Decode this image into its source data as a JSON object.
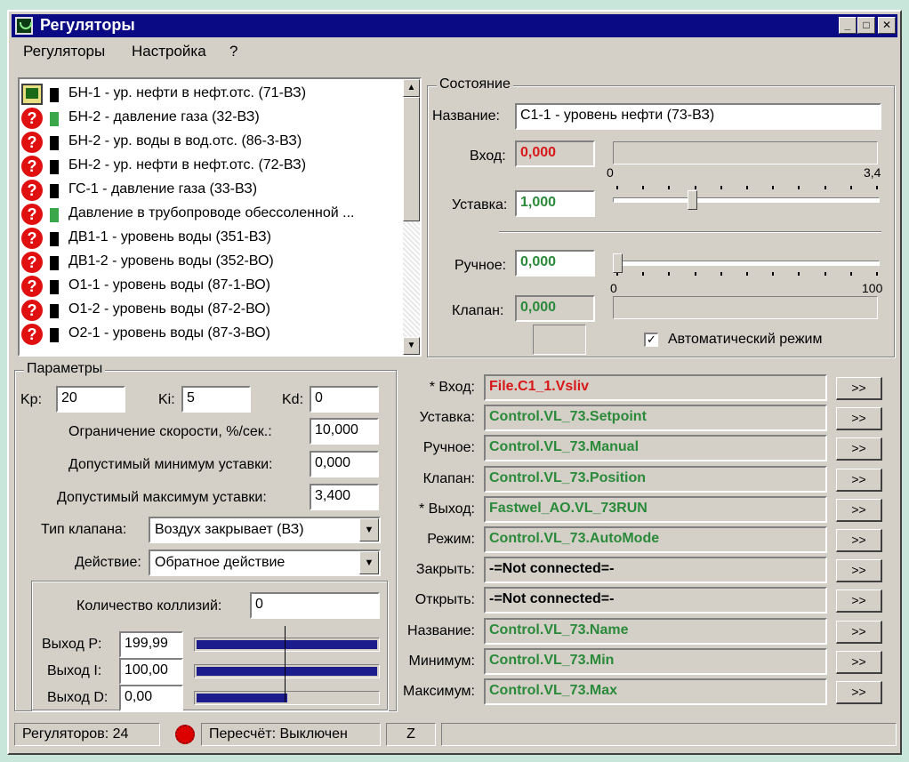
{
  "window": {
    "title": "Регуляторы",
    "buttons": {
      "minimize": "_",
      "maximize": "□",
      "close": "✕"
    }
  },
  "menu": [
    "Регуляторы",
    "Настройка",
    "?"
  ],
  "list": {
    "items": [
      {
        "label": "БН-1 - ур. нефти в нефт.отс. (71-ВЗ)",
        "status": "ok",
        "indicator": "black"
      },
      {
        "label": "БН-2 - давление газа (32-ВЗ)",
        "status": "unknown",
        "indicator": "green"
      },
      {
        "label": "БН-2 - ур. воды в вод.отс. (86-3-ВЗ)",
        "status": "unknown",
        "indicator": "black"
      },
      {
        "label": "БН-2 - ур. нефти в нефт.отс. (72-ВЗ)",
        "status": "unknown",
        "indicator": "black"
      },
      {
        "label": "ГС-1 - давление газа (33-ВЗ)",
        "status": "unknown",
        "indicator": "black"
      },
      {
        "label": "Давление в трубопроводе обессоленной ...",
        "status": "unknown",
        "indicator": "green"
      },
      {
        "label": "ДВ1-1 - уровень воды (351-ВЗ)",
        "status": "unknown",
        "indicator": "black"
      },
      {
        "label": "ДВ1-2 - уровень воды (352-ВО)",
        "status": "unknown",
        "indicator": "black"
      },
      {
        "label": "О1-1 - уровень воды (87-1-ВО)",
        "status": "unknown",
        "indicator": "black"
      },
      {
        "label": "О1-2 - уровень воды (87-2-ВО)",
        "status": "unknown",
        "indicator": "black"
      },
      {
        "label": "О2-1 - уровень воды (87-3-ВО)",
        "status": "unknown",
        "indicator": "black"
      }
    ],
    "unknown_glyph": "?"
  },
  "state": {
    "title": "Состояние",
    "name_label": "Название:",
    "name_value": "С1-1 - уровень нефти (73-ВЗ)",
    "input_label": "Вход:",
    "input_value": "0,000",
    "scale_min": "0",
    "scale_max": "3,4",
    "setpoint_label": "Уставка:",
    "setpoint_value": "1,000",
    "setpoint_fraction": 0.29,
    "manual_label": "Ручное:",
    "manual_value": "0,000",
    "manual_fraction": 0.0,
    "manual_scale_min": "0",
    "manual_scale_max": "100",
    "valve_label": "Клапан:",
    "valve_value": "0,000",
    "auto_mode_label": "Автоматический режим",
    "auto_mode_checked": "✓"
  },
  "params": {
    "title": "Параметры",
    "kp_label": "Kp:",
    "kp": "20",
    "ki_label": "Ki:",
    "ki": "5",
    "kd_label": "Kd:",
    "kd": "0",
    "speed_limit_label": "Ограничение скорости, %/сек.:",
    "speed_limit": "10,000",
    "min_setpoint_label": "Допустимый минимум уставки:",
    "min_setpoint": "0,000",
    "max_setpoint_label": "Допустимый максимум уставки:",
    "max_setpoint": "3,400",
    "valve_type_label": "Тип клапана:",
    "valve_type": "Воздух закрывает (ВЗ)",
    "action_label": "Действие:",
    "action": "Обратное действие",
    "collisions_label": "Количество коллизий:",
    "collisions": "0",
    "outputs": [
      {
        "label": "Выход P:",
        "value": "199,99",
        "fraction": 1.0
      },
      {
        "label": "Выход I:",
        "value": "100,00",
        "fraction": 1.0
      },
      {
        "label": "Выход D:",
        "value": "0,00",
        "fraction": 0.5
      }
    ]
  },
  "bindings": {
    "button_label": ">>",
    "rows": [
      {
        "label": "* Вход:",
        "value": "File.C1_1.Vsliv",
        "color": "#d81818"
      },
      {
        "label": "Уставка:",
        "value": "Control.VL_73.Setpoint",
        "color": "#2a8a3a"
      },
      {
        "label": "Ручное:",
        "value": "Control.VL_73.Manual",
        "color": "#2a8a3a"
      },
      {
        "label": "Клапан:",
        "value": "Control.VL_73.Position",
        "color": "#2a8a3a"
      },
      {
        "label": "* Выход:",
        "value": "Fastwel_AO.VL_73RUN",
        "color": "#2a8a3a"
      },
      {
        "label": "Режим:",
        "value": "Control.VL_73.AutoMode",
        "color": "#2a8a3a"
      },
      {
        "label": "Закрыть:",
        "value": "-=Not connected=-",
        "color": "#000000"
      },
      {
        "label": "Открыть:",
        "value": "-=Not connected=-",
        "color": "#000000"
      },
      {
        "label": "Название:",
        "value": "Control.VL_73.Name",
        "color": "#2a8a3a"
      },
      {
        "label": "Минимум:",
        "value": "Control.VL_73.Min",
        "color": "#2a8a3a"
      },
      {
        "label": "Максимум:",
        "value": "Control.VL_73.Max",
        "color": "#2a8a3a"
      }
    ]
  },
  "statusbar": {
    "regulators": "Регуляторов: 24",
    "recalc": "Пересчёт: Выключен",
    "z": "Z"
  }
}
